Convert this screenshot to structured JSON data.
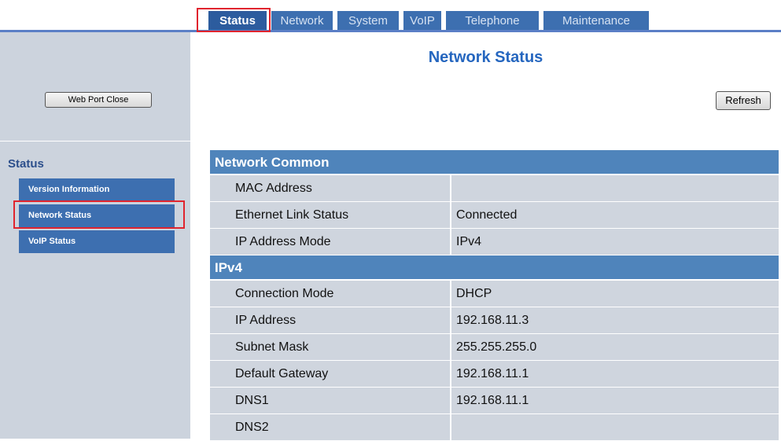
{
  "tabs": [
    "Status",
    "Network",
    "System",
    "VoIP",
    "Telephone",
    "Maintenance"
  ],
  "active_tab": "Status",
  "sidebar": {
    "web_port_button": "Web Port Close",
    "section_title": "Status",
    "items": [
      "Version Information",
      "Network Status",
      "VoIP Status"
    ],
    "selected_item": "Network Status"
  },
  "main": {
    "title": "Network Status",
    "refresh_button": "Refresh",
    "sections": [
      {
        "header": "Network Common",
        "rows": [
          {
            "label": "MAC Address",
            "value": ""
          },
          {
            "label": "Ethernet Link Status",
            "value": "Connected"
          },
          {
            "label": "IP Address Mode",
            "value": "IPv4"
          }
        ]
      },
      {
        "header": "IPv4",
        "rows": [
          {
            "label": "Connection Mode",
            "value": "DHCP"
          },
          {
            "label": "IP Address",
            "value": "192.168.11.3"
          },
          {
            "label": "Subnet Mask",
            "value": "255.255.255.0"
          },
          {
            "label": "Default Gateway",
            "value": "192.168.11.1"
          },
          {
            "label": "DNS1",
            "value": "192.168.11.1"
          },
          {
            "label": "DNS2",
            "value": ""
          }
        ]
      }
    ]
  },
  "colors": {
    "tab_bg": "#3d6fb0",
    "section_header_bg": "#4f84bb",
    "row_bg": "#cfd5de",
    "title_text": "#2566bf",
    "highlight_border": "#e0242e"
  }
}
